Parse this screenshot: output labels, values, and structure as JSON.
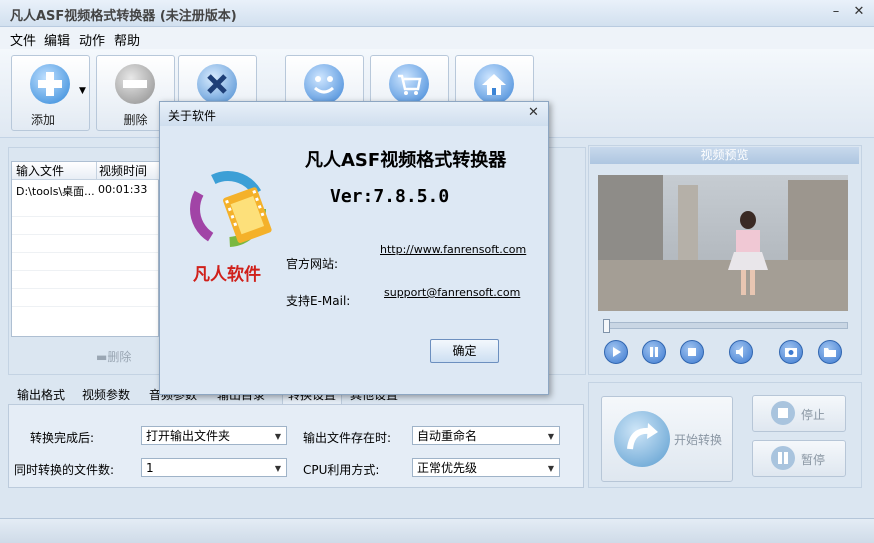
{
  "app": {
    "title": "凡人ASF视频格式转换器  (未注册版本)"
  },
  "menu": [
    "文件",
    "编辑",
    "动作",
    "帮助"
  ],
  "toolbar": {
    "add_label": "添加",
    "delete_label": "删除"
  },
  "file_list": {
    "columns": [
      "输入文件",
      "视频时间"
    ],
    "rows": [
      {
        "file": "D:\\tools\\桌面...",
        "time": "00:01:33"
      }
    ],
    "delete_label": "删除"
  },
  "tabs": [
    "输出格式",
    "视频参数",
    "音频参数",
    "输出目录",
    "转换设置",
    "其他设置"
  ],
  "options": {
    "after_convert_label": "转换完成后:",
    "after_convert_value": "打开输出文件夹",
    "file_exists_label": "输出文件存在时:",
    "file_exists_value": "自动重命名",
    "concurrent_label": "同时转换的文件数:",
    "concurrent_value": "1",
    "cpu_label": "CPU利用方式:",
    "cpu_value": "正常优先级"
  },
  "preview": {
    "title": "视频预览"
  },
  "actions": {
    "start_label": "开始转换",
    "stop_label": "停止",
    "pause_label": "暂停"
  },
  "dialog": {
    "title": "关于软件",
    "product_name": "凡人ASF视频格式转换器",
    "version": "Ver:7.8.5.0",
    "logo_text": "凡人软件",
    "website_label": "官方网站:",
    "website_value": "http://www.fanrensoft.com",
    "email_label": "支持E-Mail:",
    "email_value": "support@fanrensoft.com",
    "ok_label": "确定"
  },
  "colors": {
    "accent": "#3d7ad0",
    "logo_red": "#d0201a"
  }
}
